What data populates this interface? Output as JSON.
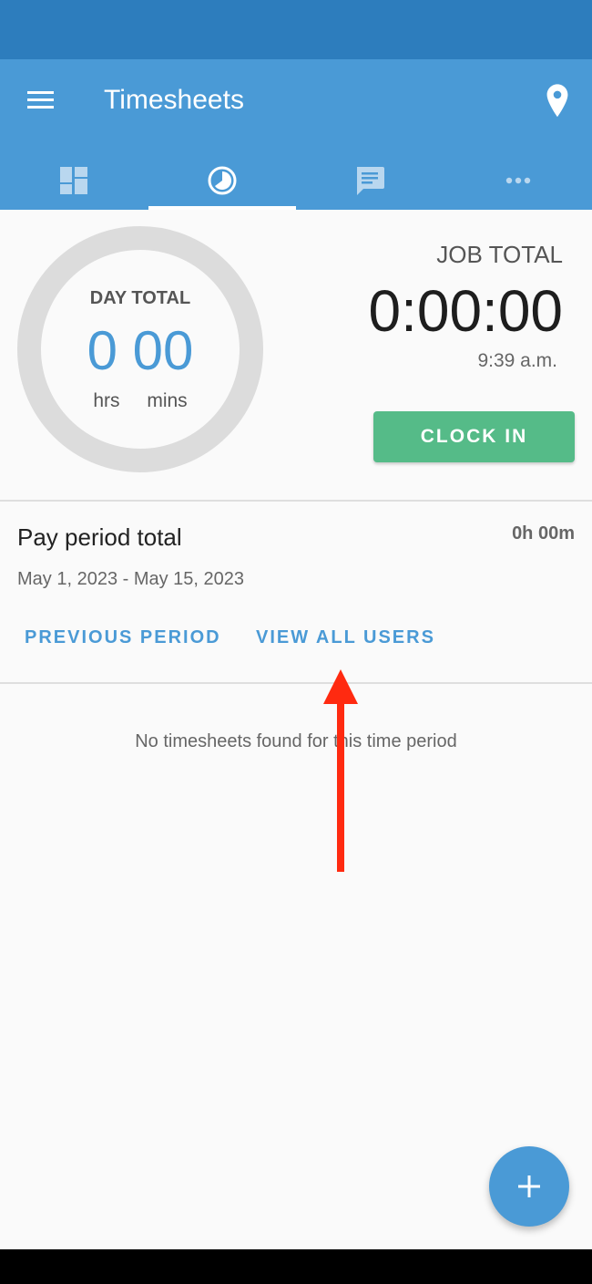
{
  "app_bar": {
    "title": "Timesheets",
    "menu_icon": "hamburger-menu-icon",
    "location_icon": "map-pin-icon",
    "background_color": "#4a9ad6",
    "status_bar_color": "#2d7dbd"
  },
  "tabs": [
    {
      "name": "dashboard",
      "icon": "dashboard-icon",
      "active": false
    },
    {
      "name": "timesheets",
      "icon": "clock-icon",
      "active": true
    },
    {
      "name": "messages",
      "icon": "chat-icon",
      "active": false
    },
    {
      "name": "more",
      "icon": "more-horizontal-icon",
      "active": false
    }
  ],
  "day_total": {
    "label": "DAY TOTAL",
    "hours": "0",
    "minutes": "00",
    "hours_unit": "hrs",
    "minutes_unit": "mins",
    "progress": 0
  },
  "job_total": {
    "label": "JOB TOTAL",
    "time": "0:00:00",
    "current_time": "9:39 a.m.",
    "clock_in_label": "CLOCK IN",
    "clock_in_color": "#55bb88"
  },
  "pay_period": {
    "title": "Pay period total",
    "total": "0h 00m",
    "range": "May 1, 2023 - May 15, 2023",
    "previous_label": "PREVIOUS PERIOD",
    "view_all_label": "VIEW ALL USERS"
  },
  "empty_state": {
    "message": "No timesheets found for this time period"
  },
  "fab": {
    "icon": "plus-icon"
  },
  "annotation": {
    "type": "arrow",
    "color": "#ff2a10",
    "points_to": "VIEW ALL USERS"
  }
}
